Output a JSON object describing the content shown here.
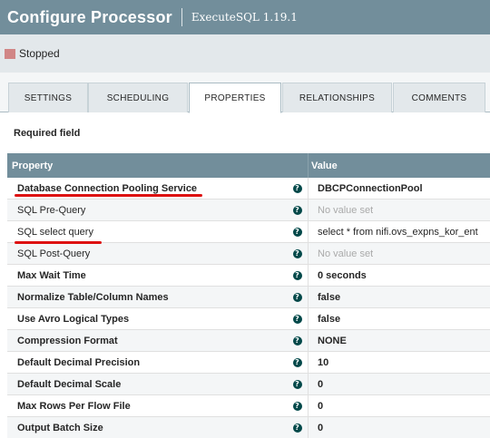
{
  "dialog": {
    "title": "Configure Processor",
    "subtitle": "ExecuteSQL 1.19.1"
  },
  "status": {
    "label": "Stopped",
    "color": "#d18686"
  },
  "tabs": [
    {
      "label": "SETTINGS"
    },
    {
      "label": "SCHEDULING"
    },
    {
      "label": "PROPERTIES"
    },
    {
      "label": "RELATIONSHIPS"
    },
    {
      "label": "COMMENTS"
    }
  ],
  "active_tab": "PROPERTIES",
  "required_label": "Required field",
  "table": {
    "headers": {
      "property": "Property",
      "value": "Value"
    },
    "rows": [
      {
        "name": "Database Connection Pooling Service",
        "value": "DBCPConnectionPool",
        "required": true,
        "highlighted": true
      },
      {
        "name": "SQL Pre-Query",
        "value": "No value set",
        "required": false,
        "empty": true
      },
      {
        "name": "SQL select query",
        "value": "select * from nifi.ovs_expns_kor_ent",
        "required": false,
        "highlighted": true
      },
      {
        "name": "SQL Post-Query",
        "value": "No value set",
        "required": false,
        "empty": true
      },
      {
        "name": "Max Wait Time",
        "value": "0 seconds",
        "required": true
      },
      {
        "name": "Normalize Table/Column Names",
        "value": "false",
        "required": true
      },
      {
        "name": "Use Avro Logical Types",
        "value": "false",
        "required": true
      },
      {
        "name": "Compression Format",
        "value": "NONE",
        "required": true
      },
      {
        "name": "Default Decimal Precision",
        "value": "10",
        "required": true
      },
      {
        "name": "Default Decimal Scale",
        "value": "0",
        "required": true
      },
      {
        "name": "Max Rows Per Flow File",
        "value": "0",
        "required": true
      },
      {
        "name": "Output Batch Size",
        "value": "0",
        "required": true
      }
    ]
  },
  "icons": {
    "help": "help-circle-icon",
    "stopped": "stop-square-icon"
  },
  "colors": {
    "header": "#728e9b",
    "help": "#004849",
    "annotation": "#dd1111"
  }
}
